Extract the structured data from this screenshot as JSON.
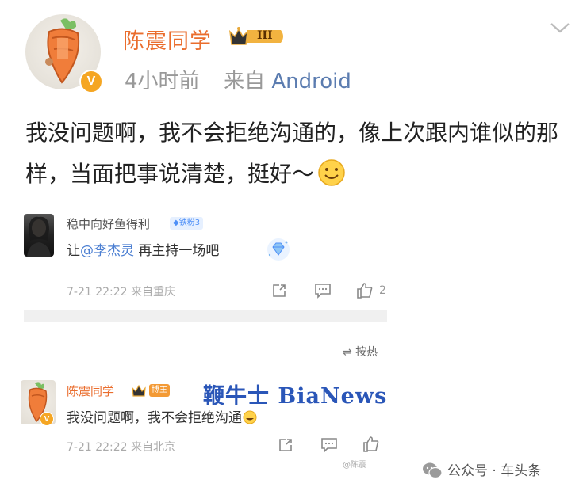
{
  "post": {
    "author": "陈震同学",
    "level_badge": "III",
    "time": "4小时前",
    "source_prefix": "来自",
    "source": "Android",
    "text": "我没问题啊，我不会拒绝沟通的，像上次跟内谁似的那样，当面把事说清楚，挺好～"
  },
  "comments": [
    {
      "author": "稳中向好鱼得利",
      "badge": "铁粉3",
      "text_prefix": "让",
      "mention": "@李杰灵",
      "text_suffix": " 再主持一场吧",
      "time": "7-21 22:22",
      "location": "来自重庆",
      "like_count": "2"
    },
    {
      "author": "陈震同学",
      "badge": "博主",
      "text": "我没问题啊，我不会拒绝沟通",
      "time": "7-21 22:22",
      "location": "来自北京"
    }
  ],
  "sort_label": "按热",
  "watermark": "鞭牛士 BiaNews",
  "mini_watermark": "@陈震",
  "footer": "公众号 · 车头条",
  "colors": {
    "author_orange": "#ea6d2d",
    "link_blue": "#5b7cb0",
    "mention_blue": "#4c7fd2",
    "watermark_blue": "#2a56b8",
    "verified_gold": "#f5a623"
  }
}
